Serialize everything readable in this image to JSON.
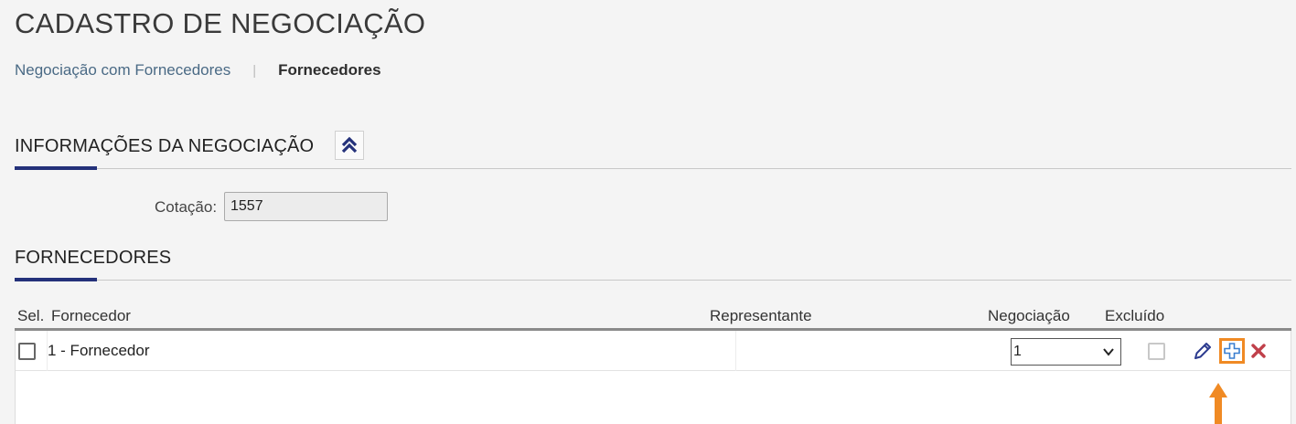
{
  "page": {
    "title": "CADASTRO DE NEGOCIAÇÃO"
  },
  "breadcrumb": {
    "parent": "Negociação com Fornecedores",
    "separator": "|",
    "current": "Fornecedores"
  },
  "section_info": {
    "title": "INFORMAÇÕES DA NEGOCIAÇÃO",
    "collapse_icon": "double-chevron-up-icon"
  },
  "cotacao": {
    "label": "Cotação:",
    "value": "1557"
  },
  "section_fornecedores": {
    "title": "FORNECEDORES"
  },
  "grid": {
    "columns": {
      "sel": "Sel.",
      "fornecedor": "Fornecedor",
      "representante": "Representante",
      "negociacao": "Negociação",
      "excluido": "Excluído"
    },
    "rows": [
      {
        "selected": false,
        "fornecedor": "1 - Fornecedor",
        "representante": "",
        "negociacao": "1",
        "excluido": false
      }
    ]
  },
  "colors": {
    "accent": "#24317a",
    "highlight": "#f08a24",
    "delete": "#c0404a",
    "link": "#4a6a85"
  }
}
